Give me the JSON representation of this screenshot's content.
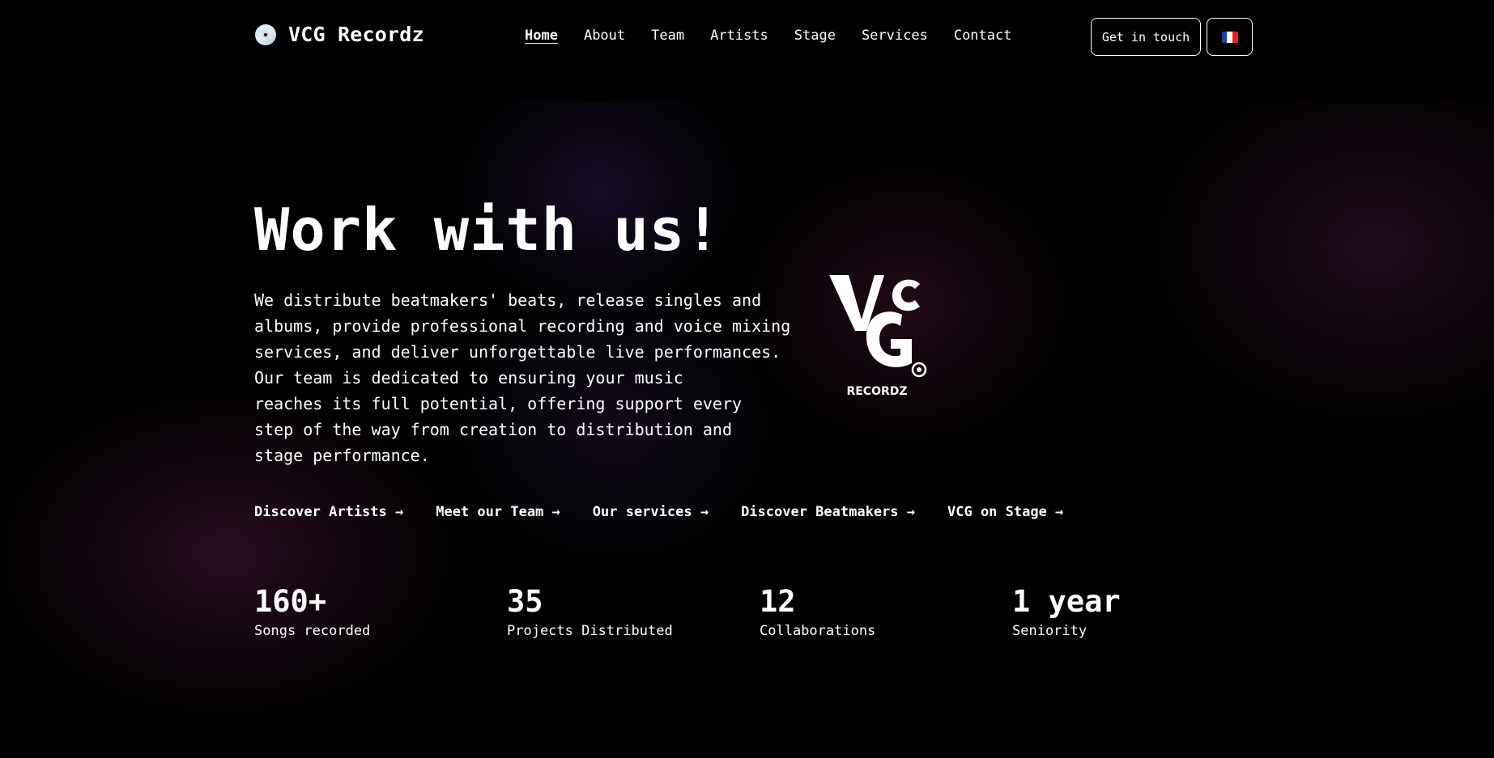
{
  "header": {
    "brand_icon": "cd-disc-icon",
    "brand_name": "VCG Recordz",
    "nav": [
      {
        "label": "Home",
        "active": true
      },
      {
        "label": "About",
        "active": false
      },
      {
        "label": "Team",
        "active": false
      },
      {
        "label": "Artists",
        "active": false
      },
      {
        "label": "Stage",
        "active": false
      },
      {
        "label": "Services",
        "active": false
      },
      {
        "label": "Contact",
        "active": false
      }
    ],
    "cta_label": "Get in touch",
    "language_flag": "french-flag-icon"
  },
  "hero": {
    "title": "Work with us!",
    "description_lines": [
      "We distribute beatmakers' beats, release singles and",
      "albums, provide professional recording and voice mixing",
      "services, and deliver unforgettable live performances.",
      "Our team is dedicated to ensuring your music",
      "reaches its full potential, offering support every",
      "step of the way from creation to distribution and",
      "stage performance."
    ],
    "logo_text": "RECORDZ",
    "links": [
      "Discover Artists →",
      "Meet our Team →",
      "Our services →",
      "Discover Beatmakers →",
      "VCG on Stage →"
    ]
  },
  "stats": [
    {
      "value": "160+",
      "label": "Songs recorded"
    },
    {
      "value": "35",
      "label": "Projects Distributed"
    },
    {
      "value": "12",
      "label": "Collaborations"
    },
    {
      "value": "1 year",
      "label": "Seniority"
    }
  ],
  "colors": {
    "background": "#000000",
    "text": "#ffffff",
    "glow_purple": "#2a1646",
    "glow_magenta": "#46183c"
  }
}
